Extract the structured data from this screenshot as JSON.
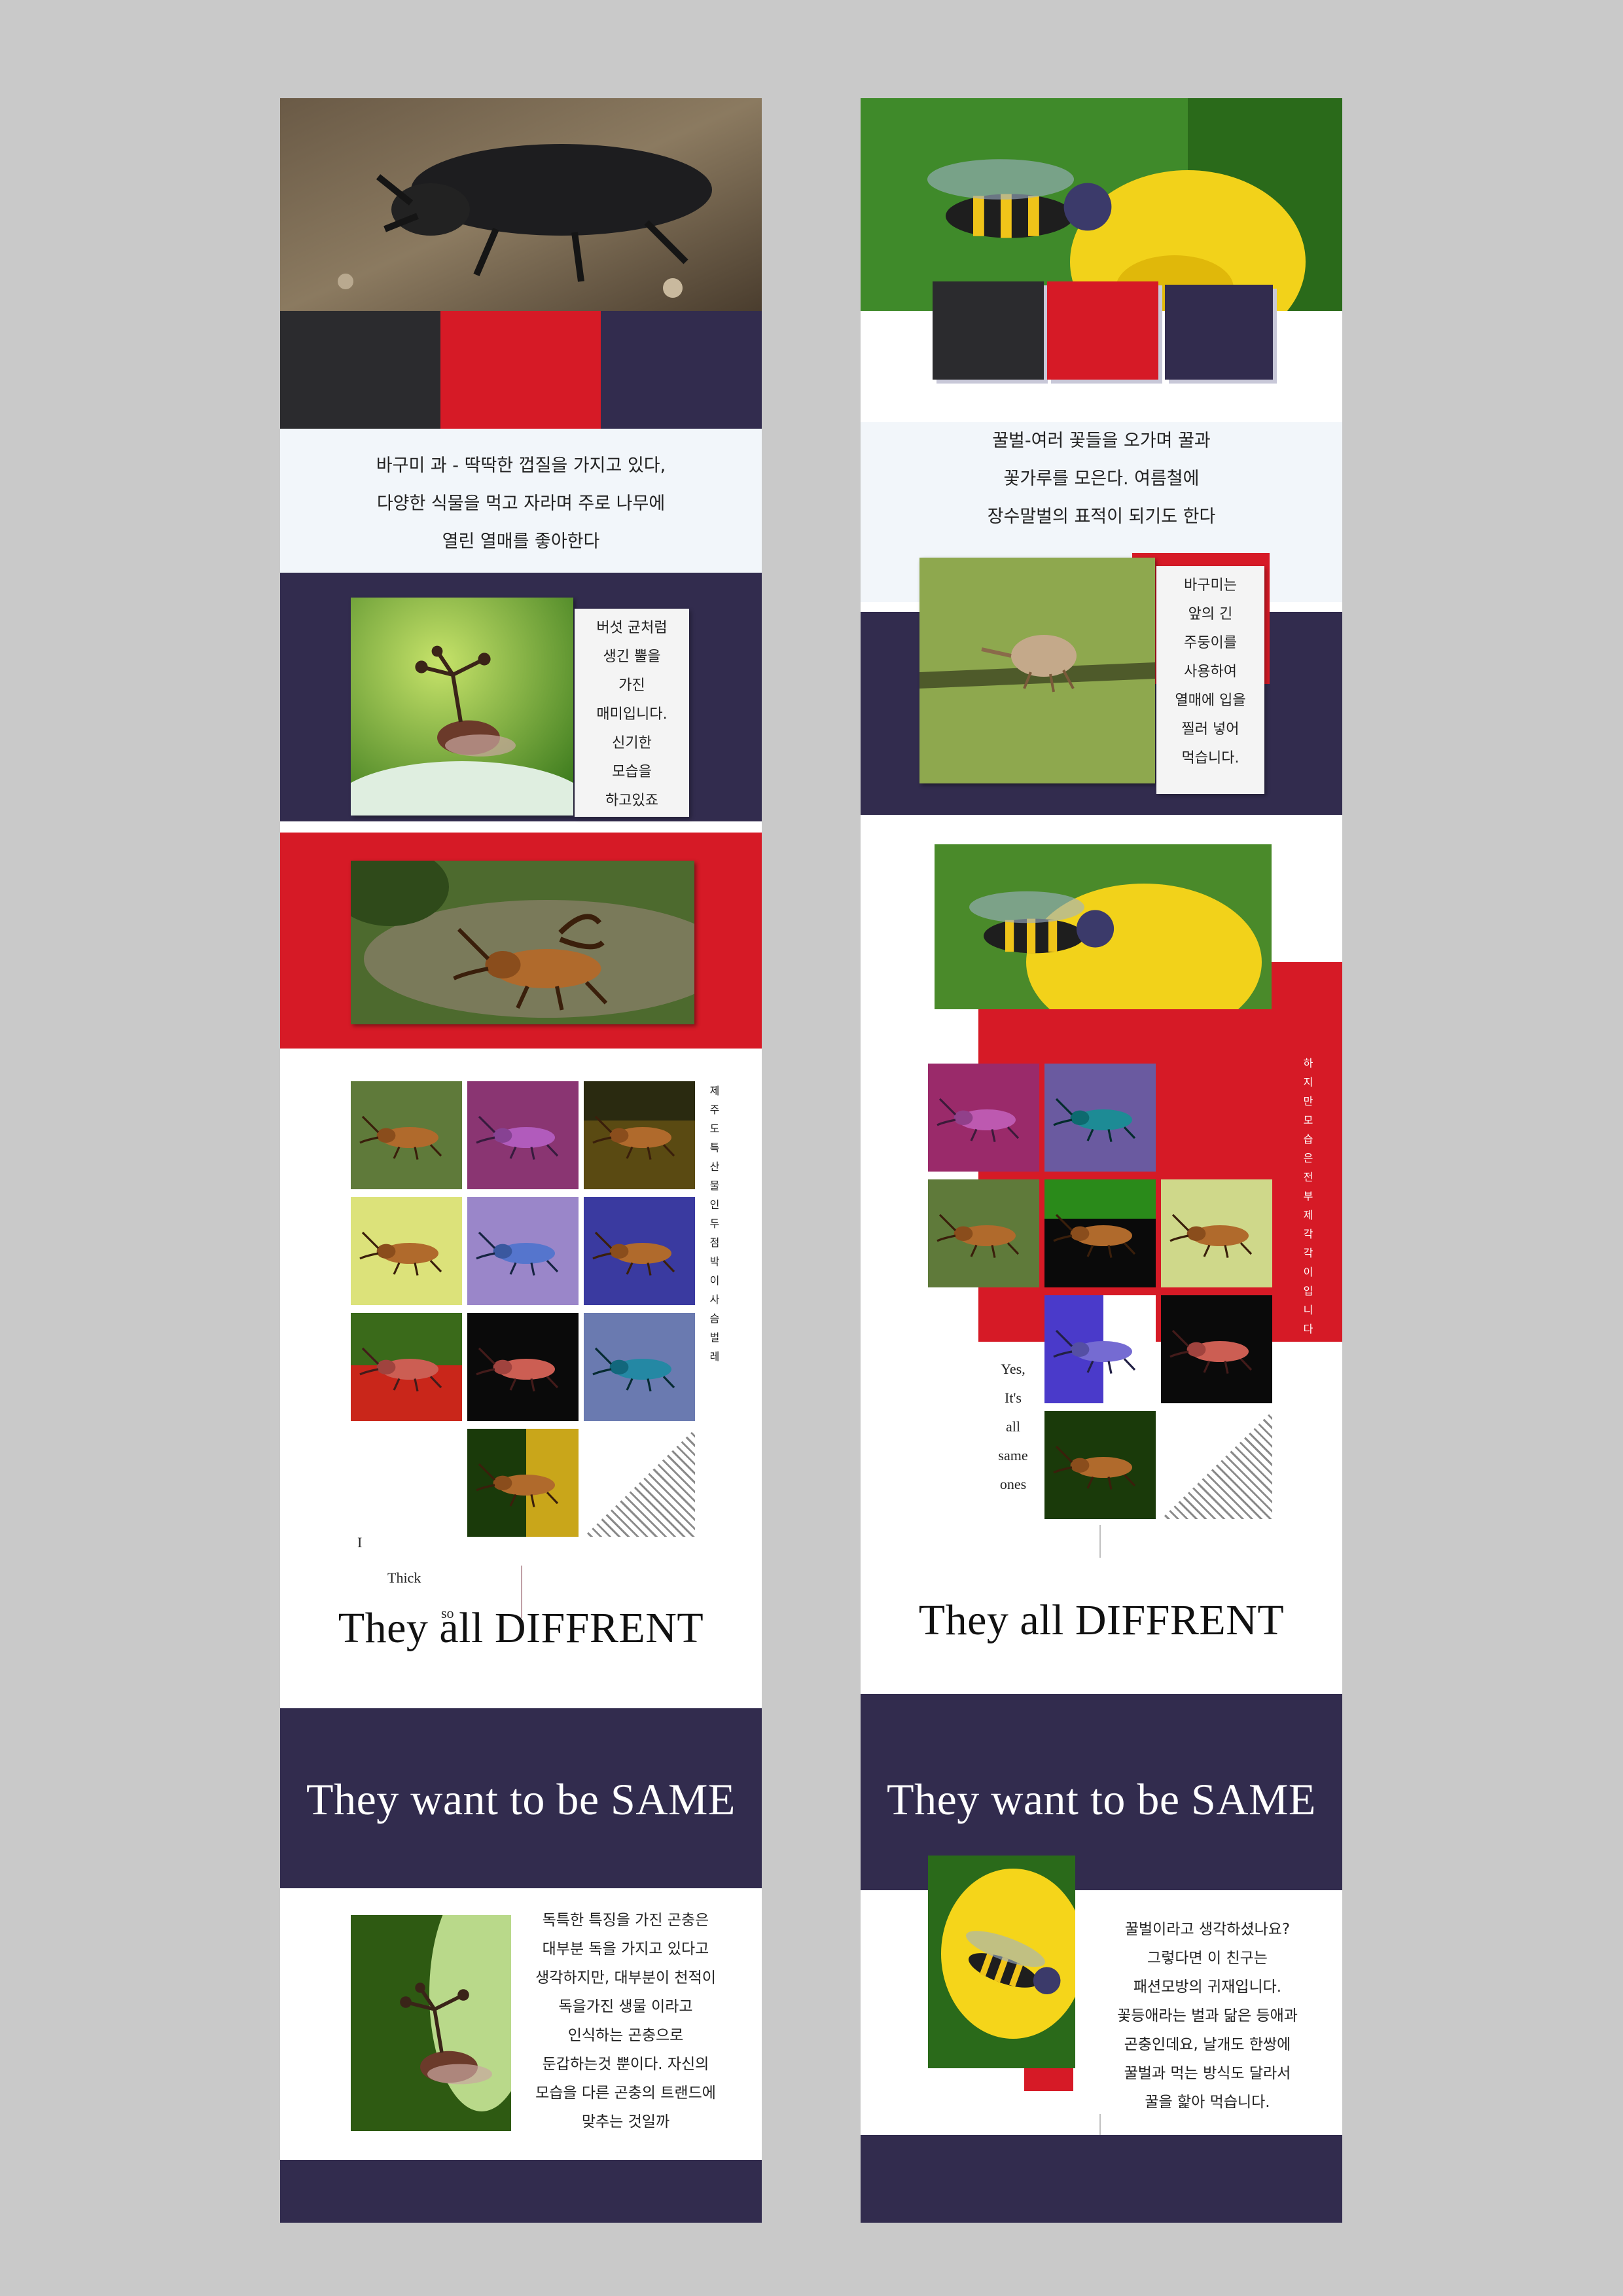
{
  "left_page": {
    "intro_text": [
      "바구미 과 - 딱딱한 껍질을 가지고 있다,",
      "다양한 식물을 먹고 자라며 주로 나무에",
      "열린 열매를 좋아한다"
    ],
    "treehopper_text": [
      "버섯 균처럼",
      "생긴 뿔을",
      "가진",
      "매미입니다.",
      "신기한",
      "모습을",
      "하고있죠"
    ],
    "vertical_caption": "제주도특산물인두점박이사슴벌레",
    "side_words": [
      "I",
      "Thick",
      "so"
    ],
    "heading_different": "They all DIFFRENT",
    "heading_same": "They want to be SAME",
    "bottom_text": [
      "독특한 특징을 가진 곤충은",
      "대부분 독을 가지고 있다고",
      "생각하지만, 대부분이 천적이",
      "독을가진 생물 이라고",
      "인식하는 곤충으로",
      "둔갑하는것 뿐이다. 자신의",
      "모습을 다른 곤충의 트랜드에",
      "맞추는 것일까"
    ]
  },
  "right_page": {
    "intro_text": [
      "꿀벌-여러 꽃들을 오가며 꿀과",
      "꽃가루를 모은다. 여름철에",
      "장수말벌의 표적이 되기도 한다"
    ],
    "weevil_text": [
      "바구미는",
      "앞의 긴",
      "주둥이를",
      "사용하여",
      "열매에 입을",
      "찔러 넣어",
      "먹습니다."
    ],
    "vertical_caption": "하지만모습은전부제각각이입니다",
    "side_words": [
      "Yes,",
      "It's",
      "all",
      "same",
      "ones"
    ],
    "heading_different": "They all DIFFRENT",
    "heading_same": "They want to be SAME",
    "bottom_text": [
      "꿀벌이라고 생각하셨나요?",
      "그렇다면 이 친구는",
      "패션모방의 귀재입니다.",
      "꽃등애라는 벌과 닮은 등애과",
      "곤충인데요, 날개도 한쌍에",
      "꿀벌과 먹는 방식도 달라서",
      "꿀을 핥아 먹습니다."
    ]
  },
  "colors": {
    "navy": "#322c4e",
    "red": "#d61a26",
    "charcoal": "#2b2b2e",
    "background": "#c9c9c9"
  }
}
